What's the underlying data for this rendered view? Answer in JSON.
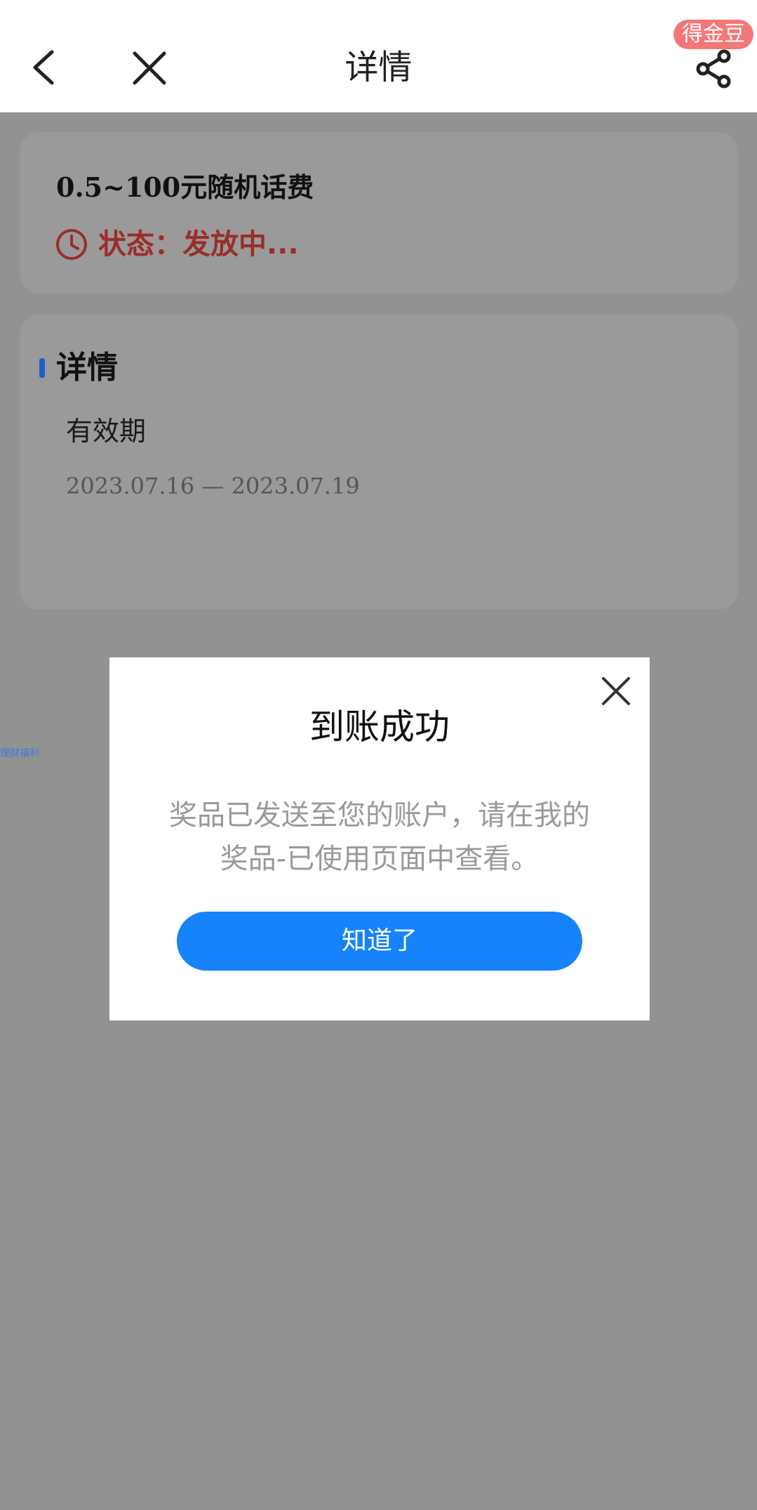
{
  "navbar": {
    "title": "详情",
    "back_icon": "chevron-left-icon",
    "close_icon": "close-icon",
    "share_icon": "share-icon",
    "coin_badge": "得金豆"
  },
  "prize": {
    "name": "0.5~100元随机话费",
    "status_icon": "clock-icon",
    "status": "状态：发放中...",
    "status_color": "#9a2d2a"
  },
  "detail": {
    "section_title": "详情",
    "accent_color": "#1a63c6",
    "validity_label": "有效期",
    "validity_range": "2023.07.16 — 2023.07.19"
  },
  "side_tag": "理财福利",
  "modal": {
    "title": "到账成功",
    "message": "奖品已发送至您的账户，请在我的奖品-已使用页面中查看。",
    "confirm_label": "知道了",
    "close_icon": "close-icon",
    "button_color": "#1783fa"
  }
}
